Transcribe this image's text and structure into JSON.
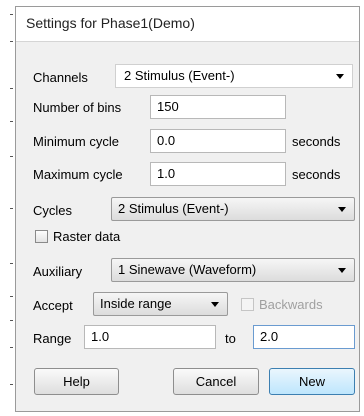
{
  "dialog": {
    "title": "Settings for Phase1(Demo)"
  },
  "channels": {
    "label": "Channels",
    "value": "2 Stimulus (Event-)"
  },
  "bins": {
    "label": "Number of bins",
    "value": "150"
  },
  "min_cycle": {
    "label": "Minimum cycle",
    "value": "0.0",
    "unit": "seconds"
  },
  "max_cycle": {
    "label": "Maximum cycle",
    "value": "1.0",
    "unit": "seconds"
  },
  "cycles": {
    "label": "Cycles",
    "value": "2 Stimulus (Event-)"
  },
  "raster": {
    "label": "Raster data",
    "checked": false
  },
  "auxiliary": {
    "label": "Auxiliary",
    "value": "1 Sinewave (Waveform)"
  },
  "accept": {
    "label": "Accept",
    "value": "Inside range"
  },
  "backwards": {
    "label": "Backwards",
    "checked": false,
    "enabled": false
  },
  "range": {
    "label": "Range",
    "from": "1.0",
    "to_label": "to",
    "to": "2.0"
  },
  "buttons": {
    "help": "Help",
    "cancel": "Cancel",
    "new": "New"
  }
}
